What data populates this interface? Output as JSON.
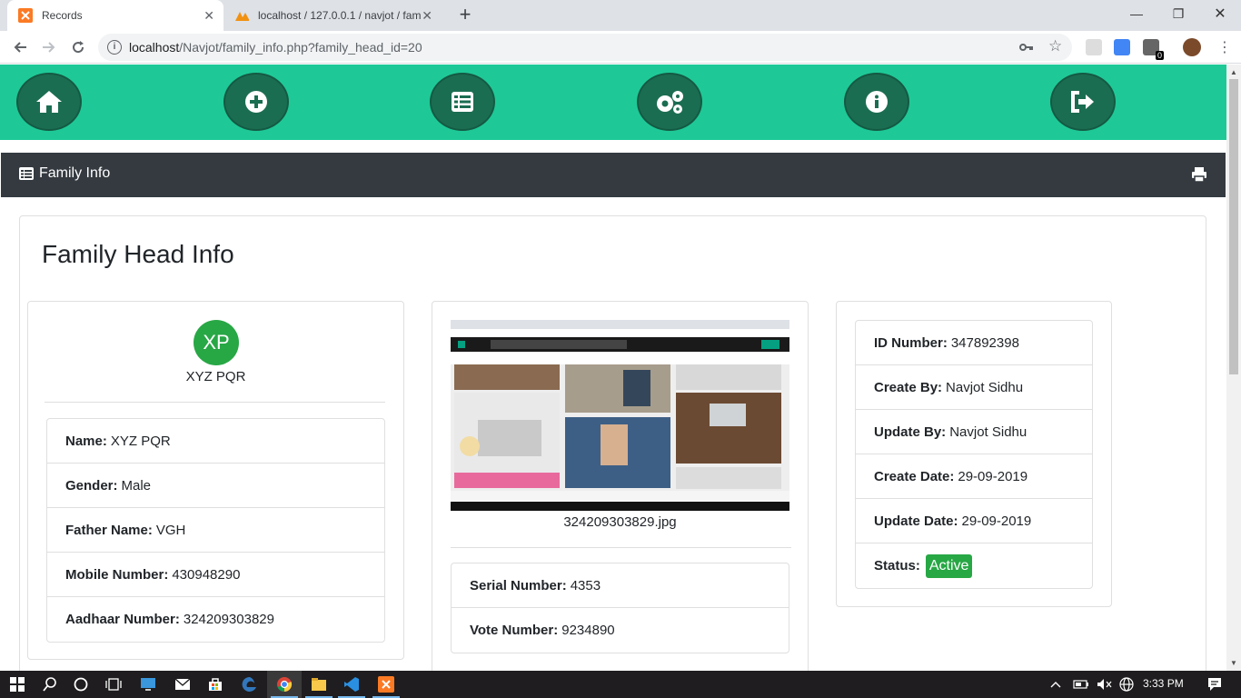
{
  "browser": {
    "tabs": [
      {
        "title": "Records",
        "active": true
      },
      {
        "title": "localhost / 127.0.0.1 / navjot / fam",
        "active": false
      }
    ],
    "url_host": "localhost",
    "url_path": "/Navjot/family_info.php?family_head_id=20",
    "extension_badge": "0"
  },
  "colors": {
    "nav_green": "#1ec997",
    "circle_dark": "#1b6d52",
    "bar_dark": "#343a40",
    "success": "#28a745"
  },
  "nav": {
    "icons": [
      "home-icon",
      "plus-circle-icon",
      "list-icon",
      "gears-icon",
      "info-circle-icon",
      "sign-out-icon"
    ]
  },
  "bar": {
    "label": "Family Info"
  },
  "page": {
    "title": "Family Head Info"
  },
  "head": {
    "initials": "XP",
    "display_name": "XYZ PQR",
    "fields": [
      {
        "label": "Name:",
        "value": "XYZ PQR"
      },
      {
        "label": "Gender:",
        "value": "Male"
      },
      {
        "label": "Father Name:",
        "value": "VGH"
      },
      {
        "label": "Mobile Number:",
        "value": "430948290"
      },
      {
        "label": "Aadhaar Number:",
        "value": "324209303829"
      }
    ]
  },
  "document": {
    "filename": "324209303829.jpg",
    "fields": [
      {
        "label": "Serial Number:",
        "value": "4353"
      },
      {
        "label": "Vote Number:",
        "value": "9234890"
      }
    ]
  },
  "meta": {
    "fields": [
      {
        "label": "ID Number:",
        "value": "347892398"
      },
      {
        "label": "Create By:",
        "value": "Navjot Sidhu"
      },
      {
        "label": "Update By:",
        "value": "Navjot Sidhu"
      },
      {
        "label": "Create Date:",
        "value": "29-09-2019"
      },
      {
        "label": "Update Date:",
        "value": "29-09-2019"
      }
    ],
    "status_label": "Status:",
    "status_value": "Active"
  },
  "taskbar": {
    "time": "3:33 PM"
  }
}
